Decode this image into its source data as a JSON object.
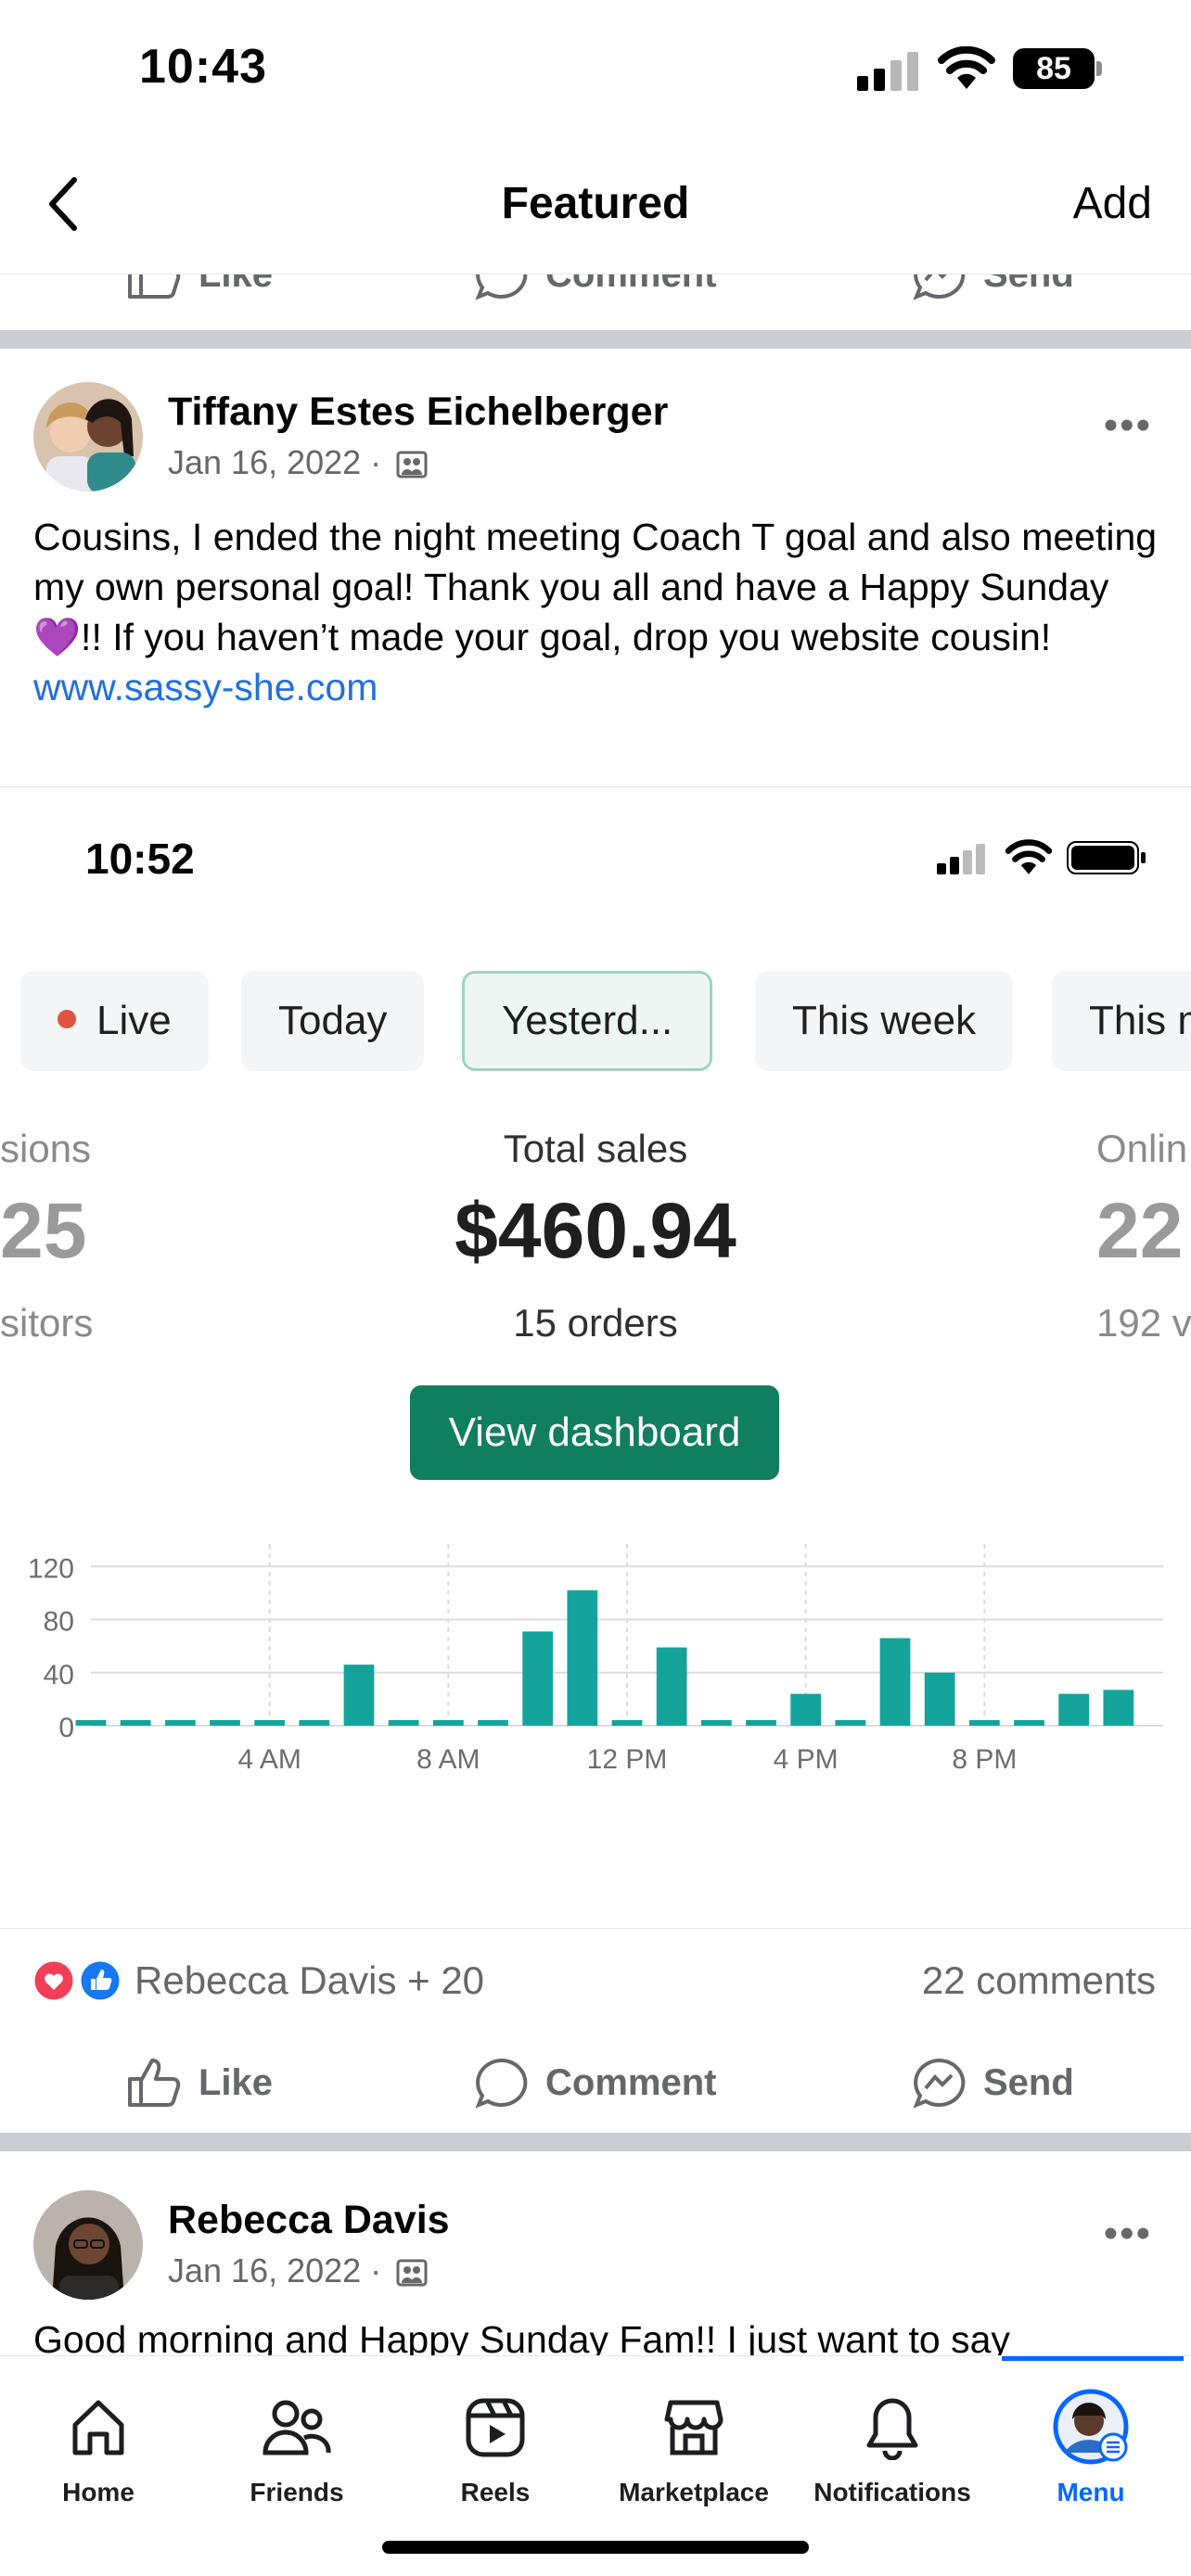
{
  "status_bar": {
    "time": "10:43",
    "battery": "85"
  },
  "nav": {
    "title": "Featured",
    "add_label": "Add"
  },
  "cut_actions": {
    "like": "Like",
    "comment": "Comment",
    "send": "Send"
  },
  "post1": {
    "author": "Tiffany Estes Eichelberger",
    "date": "Jan 16, 2022 ·",
    "text": "Cousins, I ended the night meeting Coach T goal and also meeting my own personal goal! Thank you all and have a Happy Sunday💜!! If you haven’t made your goal, drop you website cousin!",
    "link": "www.sassy-she.com",
    "embedded": {
      "time": "10:52",
      "filters": [
        {
          "label": "Live"
        },
        {
          "label": "Today"
        },
        {
          "label": "Yesterd..."
        },
        {
          "label": "This week"
        },
        {
          "label": "This m"
        }
      ],
      "left_kpi": {
        "label": "sions",
        "value": "25",
        "sub": "sitors"
      },
      "center_kpi": {
        "label": "Total sales",
        "value": "$460.94",
        "sub": "15 orders"
      },
      "right_kpi": {
        "label": "Onlin",
        "value": "22",
        "sub": "192 v"
      },
      "dashboard_button": "View dashboard"
    },
    "reactions_text": "Rebecca Davis + 20",
    "comments_count": "22 comments",
    "actions": {
      "like": "Like",
      "comment": "Comment",
      "send": "Send"
    }
  },
  "post2": {
    "author": "Rebecca Davis",
    "date": "Jan 16, 2022 ·",
    "text": "Good morning and Happy Sunday Fam!! I just want to say"
  },
  "bottom_nav": {
    "tabs": [
      {
        "label": "Home"
      },
      {
        "label": "Friends"
      },
      {
        "label": "Reels"
      },
      {
        "label": "Marketplace"
      },
      {
        "label": "Notifications"
      },
      {
        "label": "Menu"
      }
    ]
  },
  "colors": {
    "accent": "#0866ff",
    "bar": "#14a39a",
    "button": "#0f7f5f",
    "link": "#216fdb"
  },
  "chart_data": {
    "type": "bar",
    "categories": [
      "12 AM",
      "1 AM",
      "2 AM",
      "3 AM",
      "4 AM",
      "5 AM",
      "6 AM",
      "7 AM",
      "8 AM",
      "9 AM",
      "10 AM",
      "11 AM",
      "12 PM",
      "1 PM",
      "2 PM",
      "3 PM",
      "4 PM",
      "5 PM",
      "6 PM",
      "7 PM",
      "8 PM",
      "9 PM",
      "10 PM",
      "11 PM"
    ],
    "values": [
      0,
      0,
      0,
      0,
      0,
      0,
      46,
      0,
      0,
      0,
      71,
      102,
      0,
      59,
      0,
      0,
      24,
      0,
      66,
      40,
      0,
      0,
      24,
      27
    ],
    "xticks": [
      "4 AM",
      "8 AM",
      "12 PM",
      "4 PM",
      "8 PM"
    ],
    "yticks": [
      0,
      40,
      80,
      120
    ],
    "ylim": [
      0,
      130
    ],
    "grid": true
  }
}
